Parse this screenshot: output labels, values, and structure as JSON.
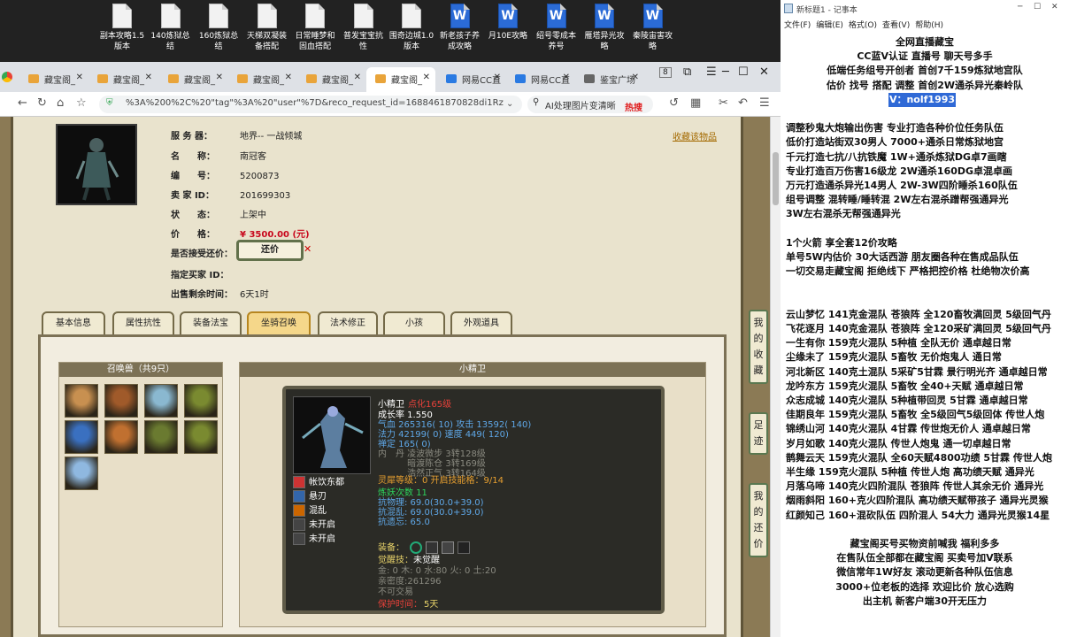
{
  "desktop": {
    "icons": [
      {
        "name": "副本攻略1.5版本",
        "type": "txt"
      },
      {
        "name": "140炼狱总结",
        "type": "txt"
      },
      {
        "name": "160炼狱总结",
        "type": "txt"
      },
      {
        "name": "天梯双凝装备搭配",
        "type": "txt"
      },
      {
        "name": "日常睡梦和固血搭配",
        "type": "txt"
      },
      {
        "name": "普发宝宝抗性",
        "type": "txt"
      },
      {
        "name": "围奇边城1.0版本",
        "type": "txt"
      },
      {
        "name": "新老孩子养成攻略",
        "type": "word"
      },
      {
        "name": "月10E攻略",
        "type": "word"
      },
      {
        "name": "绍号零成本养号",
        "type": "word"
      },
      {
        "name": "雁塔异光攻略",
        "type": "word"
      },
      {
        "name": "秦陵宙害攻略",
        "type": "word"
      }
    ]
  },
  "browser": {
    "tabs": [
      {
        "label": "藏宝阁_"
      },
      {
        "label": "藏宝阁_"
      },
      {
        "label": "藏宝阁_"
      },
      {
        "label": "藏宝阁_"
      },
      {
        "label": "藏宝阁_"
      },
      {
        "label": "藏宝阁_",
        "active": true
      },
      {
        "label": "网易CC直"
      },
      {
        "label": "网易CC直"
      },
      {
        "label": "鉴宝广场"
      }
    ],
    "tab_count": "8",
    "url": "%3A%200%2C%20\"tag\"%3A%20\"user\"%7D&reco_request_id=1688461870828di1Rz",
    "search_text": "AI处理图片变清晰",
    "hot_label": "热搜"
  },
  "listing": {
    "fields": [
      {
        "label": "服 务 器：",
        "value": "地界-- 一战倾城"
      },
      {
        "label": "名　　称：",
        "value": "南冠客"
      },
      {
        "label": "编　　号：",
        "value": "5200873"
      },
      {
        "label": "卖 家 ID：",
        "value": "201699303"
      },
      {
        "label": "状　　态：",
        "value": "上架中"
      }
    ],
    "price_label": "价　　格：",
    "price_value": "¥ 3500.00 (元)",
    "bargain_label": "是否接受还价：",
    "bargain_button": "还价",
    "buyer_label": "指定买家 ID：",
    "time_label": "出售剩余时间：",
    "time_value": "6天1时",
    "favorite": "收藏该物品"
  },
  "game_tabs": [
    "基本信息",
    "属性抗性",
    "装备法宝",
    "坐骑召唤",
    "法术修正",
    "小孩",
    "外观道具"
  ],
  "summons": {
    "title": "召唤兽（共9只）",
    "count": 9
  },
  "detail": {
    "title": "小精卫",
    "name": "小精卫",
    "evolve": "点化165级",
    "lines": [
      {
        "text": "成长率 1.550",
        "cls": "wht"
      },
      {
        "text": "气血 265316( 10) 攻击 13592( 140)",
        "cls": "blu"
      },
      {
        "text": "法力 42199( 0) 速度 449( 120)",
        "cls": "blu"
      },
      {
        "text": "禅定 165( 0)",
        "cls": "blu"
      },
      {
        "text": "内　丹  凌波微步 3转128级",
        "cls": "dim"
      },
      {
        "text": "　　　  暗渡陈仓 3转169级",
        "cls": "dim"
      },
      {
        "text": "　　　  浩然正气 3转164级",
        "cls": "dim"
      }
    ],
    "skills": [
      "帐饮东都",
      "悬刃",
      "混乱",
      "未开启",
      "未开启"
    ],
    "level_line": "灵犀等级：0 开启技能格：9/14",
    "stats": [
      "炼妖次数 11",
      "抗物理: 69.0(30.0+39.0)",
      "抗混乱: 69.0(30.0+39.0)",
      "抗遗忘: 65.0"
    ],
    "equip_label": "装备：",
    "awaken_label": "觉醒技：",
    "awaken_value": "未觉醒",
    "five_elements": "金: 0 木: 0 水:80 火: 0 土:20",
    "intimacy": "亲密度:261296",
    "tradeable": "不可交易",
    "protect_label": "保护时间：",
    "protect_value": "5天"
  },
  "side_buttons": [
    "我的收藏",
    "足迹",
    "我的还价"
  ],
  "notepad": {
    "title": "新标题1 - 记事本",
    "menu": [
      "文件(F)",
      "编辑(E)",
      "格式(O)",
      "查看(V)",
      "帮助(H)"
    ],
    "lines": [
      {
        "t": "全网直播藏宝"
      },
      {
        "t": "CC蓝V认证  直播号  聊天号多手"
      },
      {
        "t": "低端任务组号开创者        首创7千159炼狱地宫队"
      },
      {
        "t": "估价 找号 搭配 调整        首创2W通杀异光秦岭队"
      },
      {
        "t": "V：nolf1993",
        "sel": true
      },
      {
        "t": ""
      },
      {
        "t": "调整秒鬼大炮输出伤害      专业打造各种价位任务队伍"
      },
      {
        "t": "低价打造站街双30男人         7000+通杀日常炼狱地宫"
      },
      {
        "t": "千元打造七抗/八抗铁魔        1W+通杀炼狱DG卓7画瞎"
      },
      {
        "t": "专业打造百万伤害16级龙       2W通杀160DG卓混卓画"
      },
      {
        "t": "万元打造通杀异光14男人      2W-3W四阶睡杀160队伍"
      },
      {
        "t": "组号调整 混转睡/睡转混         2W左右混杀蹭帮强通异光"
      },
      {
        "t": "                                        3W左右混杀无帮强通异光"
      },
      {
        "t": ""
      },
      {
        "t": "1个火箭 享全套12价攻略"
      },
      {
        "t": "单号5W内估价 30大话西游       朋友圈各种在售成品队伍"
      },
      {
        "t": "一切交易走藏宝阁 拒绝线下     严格把控价格 杜绝物次价高"
      },
      {
        "t": ""
      },
      {
        "t": ""
      },
      {
        "t": "云山梦忆 141克金混队 苍狼阵 全120畜牧满回灵 5级回气丹"
      },
      {
        "t": "飞花逐月 140克金混队 苍狼阵 全120采矿满回灵 5级回气丹"
      },
      {
        "t": "一生有你 159克火混队 5种植 全队无价 通卓越日常"
      },
      {
        "t": "尘缘未了 159克火混队 5畜牧 无价炮鬼人 通日常"
      },
      {
        "t": "河北新区 140克土混队 5采矿5甘霖 景行明光齐 通卓越日常"
      },
      {
        "t": "龙吟东方 159克火混队 5畜牧 全40+天赋 通卓越日常"
      },
      {
        "t": "众志成城 140克火混队 5种植带回灵 5甘霖 通卓越日常"
      },
      {
        "t": "佳期良年 159克火混队 5畜牧 全5级回气5级回体 传世人炮"
      },
      {
        "t": "锦绣山河 140克火混队 4甘霖 传世炮无价人 通卓越日常"
      },
      {
        "t": "岁月如歌 140克火混队 传世人炮鬼 通一切卓越日常"
      },
      {
        "t": "鹊舞云天 159克火混队 全60天赋4800功绩 5甘霖 传世人炮"
      },
      {
        "t": "半生缘    159克火混队 5种植 传世人炮 高功绩天赋 通异光"
      },
      {
        "t": "月落乌啼 140克火四阶混队 苍狼阵 传世人其余无价 通异光"
      },
      {
        "t": "烟雨斜阳 160+克火四阶混队 高功绩天赋带孩子 通异光灵猴"
      },
      {
        "t": "红颜知己 160+混砍队伍 四阶混人 54大力 通异光灵猴14星"
      },
      {
        "t": ""
      },
      {
        "t": "藏宝阁买号买物资前喊我 福利多多"
      },
      {
        "t": "在售队伍全部都在藏宝阁 买卖号加V联系"
      },
      {
        "t": "微信常年1W好友 滚动更新各种队伍信息"
      },
      {
        "t": "3000+位老板的选择 欢迎比价 放心选购"
      },
      {
        "t": "出主机 新客户端30开无压力"
      }
    ]
  },
  "colors": {
    "price": "#c8081d",
    "tab_active": "#f5d78a",
    "notepad_sel": "#2f69d6"
  }
}
